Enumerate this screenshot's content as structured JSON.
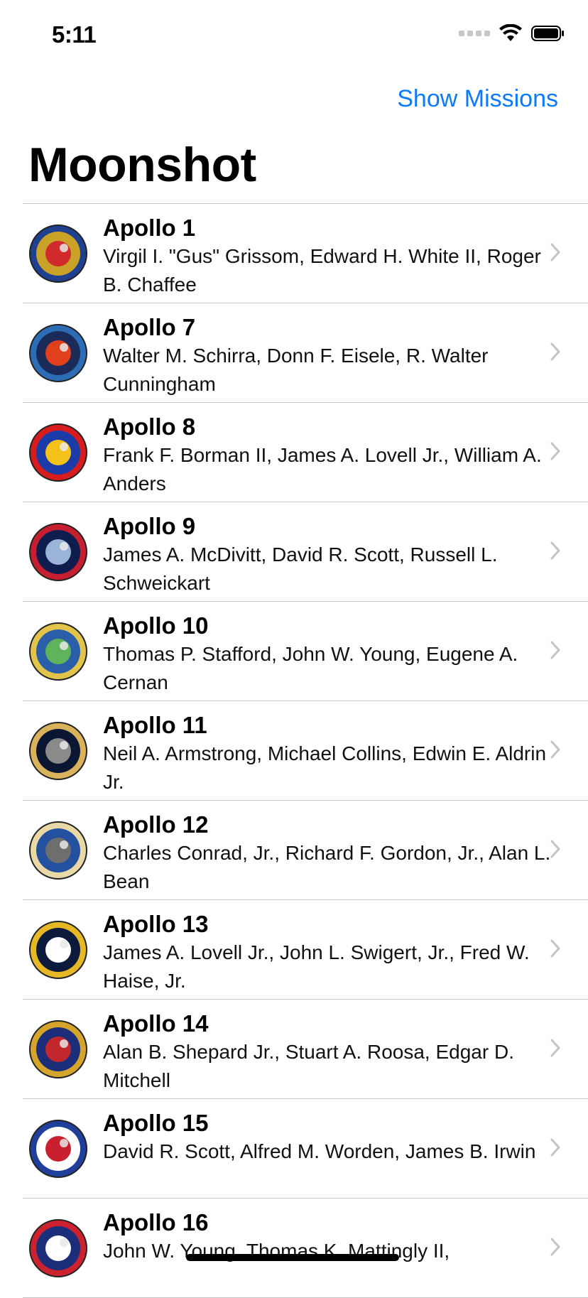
{
  "status": {
    "time": "5:11"
  },
  "nav": {
    "right_button": "Show Missions",
    "title": "Moonshot"
  },
  "missions": [
    {
      "name": "Apollo 1",
      "crew": "Virgil I. \"Gus\" Grissom, Edward H. White II, Roger B. Chaffee",
      "badge_colors": [
        "#c9a227",
        "#1f3f8f",
        "#d12a2a"
      ]
    },
    {
      "name": "Apollo 7",
      "crew": "Walter M. Schirra, Donn F. Eisele, R. Walter Cunningham",
      "badge_colors": [
        "#1a2b5a",
        "#2c6db5",
        "#e0401c"
      ]
    },
    {
      "name": "Apollo 8",
      "crew": "Frank F. Borman II, James A. Lovell Jr., William A. Anders",
      "badge_colors": [
        "#1b3ca8",
        "#d61c1c",
        "#f4c21b"
      ]
    },
    {
      "name": "Apollo 9",
      "crew": "James A. McDivitt, David R. Scott, Russell L. Schweickart",
      "badge_colors": [
        "#0e1d4d",
        "#c41e2f",
        "#9ab3d6"
      ]
    },
    {
      "name": "Apollo 10",
      "crew": "Thomas P. Stafford, John W. Young, Eugene A. Cernan",
      "badge_colors": [
        "#2a5ea8",
        "#e2c44a",
        "#5fb35a"
      ]
    },
    {
      "name": "Apollo 11",
      "crew": "Neil A. Armstrong, Michael Collins, Edwin E. Aldrin Jr.",
      "badge_colors": [
        "#0b1633",
        "#d9b35c",
        "#8a8a8a"
      ]
    },
    {
      "name": "Apollo 12",
      "crew": "Charles Conrad, Jr., Richard F. Gordon, Jr., Alan L. Bean",
      "badge_colors": [
        "#2450a0",
        "#e8d9a6",
        "#6e6e6e"
      ]
    },
    {
      "name": "Apollo 13",
      "crew": "James A. Lovell Jr., John L. Swigert, Jr., Fred W. Haise, Jr.",
      "badge_colors": [
        "#0c1a3c",
        "#e7b826",
        "#ffffff"
      ]
    },
    {
      "name": "Apollo 14",
      "crew": "Alan B. Shepard Jr., Stuart A. Roosa, Edgar D. Mitchell",
      "badge_colors": [
        "#1c2e7a",
        "#d4a52a",
        "#c1272d"
      ]
    },
    {
      "name": "Apollo 15",
      "crew": "David R. Scott, Alfred M. Worden, James B. Irwin",
      "badge_colors": [
        "#ffffff",
        "#1f3f9a",
        "#c8202f"
      ]
    },
    {
      "name": "Apollo 16",
      "crew": "John W. Young, Thomas K. Mattingly II,",
      "badge_colors": [
        "#1a2e7a",
        "#cc2230",
        "#ffffff"
      ]
    }
  ]
}
